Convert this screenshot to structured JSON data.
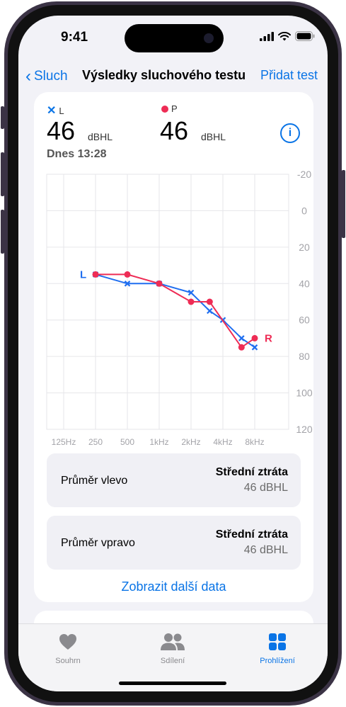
{
  "status_bar": {
    "time": "9:41"
  },
  "nav": {
    "back_label": "Sluch",
    "title": "Výsledky sluchového testu",
    "action_label": "Přidat test"
  },
  "summary": {
    "left_ear_label": "L",
    "right_ear_label": "P",
    "left_value": "46",
    "right_value": "46",
    "unit": "dBHL",
    "timestamp": "Dnes 13:28"
  },
  "colors": {
    "accent": "#0a74e6",
    "left_series": "#1f6ef0",
    "right_series": "#ee2c55",
    "card_bg": "#ffffff",
    "page_bg": "#f2f2f7"
  },
  "chart_data": {
    "type": "line",
    "x_tick_labels": [
      "125Hz",
      "250",
      "500",
      "1kHz",
      "2kHz",
      "4kHz",
      "8kHz"
    ],
    "y_tick_labels": [
      "-20",
      "0",
      "20",
      "40",
      "60",
      "80",
      "100",
      "120"
    ],
    "ylim": [
      -20,
      120
    ],
    "y_inverted": true,
    "grid": true,
    "series": [
      {
        "name": "L",
        "marker": "x",
        "color": "#1f6ef0",
        "x": [
          250,
          500,
          1000,
          2000,
          3000,
          4000,
          6000,
          8000
        ],
        "values": [
          35,
          40,
          40,
          45,
          55,
          60,
          70,
          75
        ]
      },
      {
        "name": "R",
        "marker": "circle",
        "color": "#ee2c55",
        "x": [
          250,
          500,
          1000,
          2000,
          3000,
          6000,
          8000
        ],
        "values": [
          35,
          35,
          40,
          50,
          50,
          75,
          70
        ]
      }
    ]
  },
  "averages": [
    {
      "label": "Průměr vlevo",
      "category": "Střední ztráta",
      "value": "46 dBHL"
    },
    {
      "label": "Průměr vpravo",
      "category": "Střední ztráta",
      "value": "46 dBHL"
    }
  ],
  "more_link": "Zobrazit další data",
  "tabs": [
    {
      "label": "Souhrn",
      "icon": "heart-icon",
      "active": false
    },
    {
      "label": "Sdílení",
      "icon": "people-icon",
      "active": false
    },
    {
      "label": "Prohlížení",
      "icon": "grid-icon",
      "active": true
    }
  ]
}
